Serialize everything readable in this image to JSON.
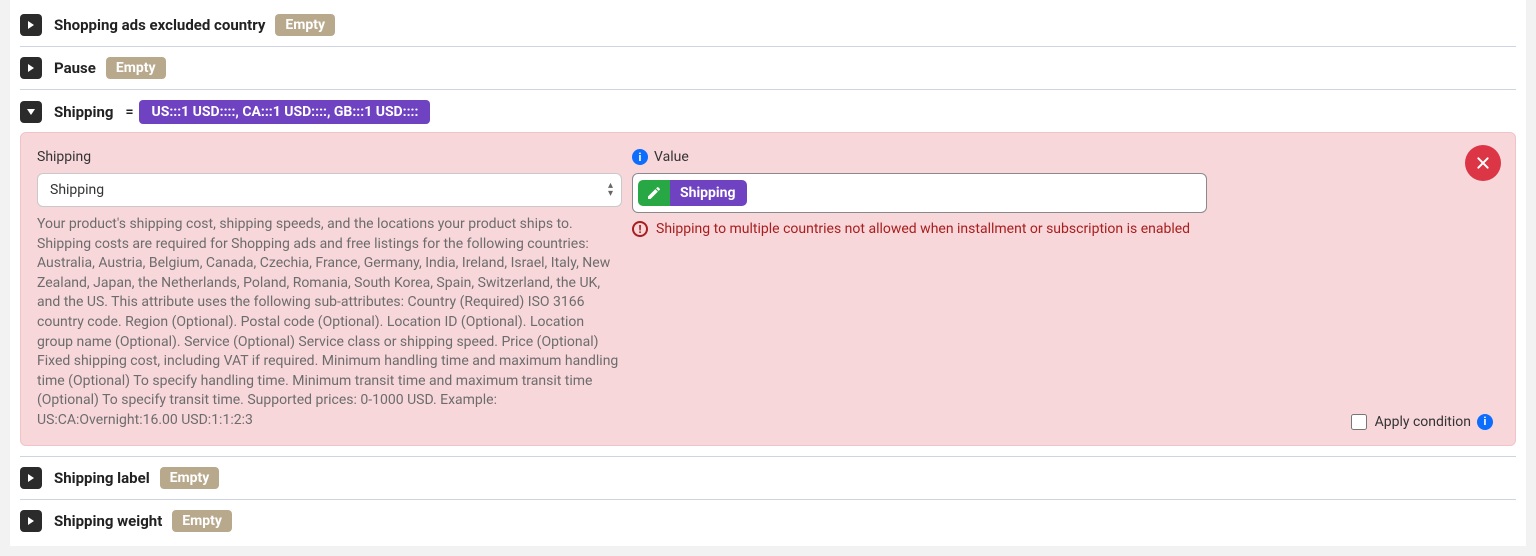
{
  "rows": {
    "excluded_country_label": "Shopping ads excluded country",
    "excluded_country_badge": "Empty",
    "pause_label": "Pause",
    "pause_badge": "Empty",
    "shipping_label": "Shipping",
    "shipping_eq": "=",
    "shipping_value_summary": "US:::1 USD::::, CA:::1 USD::::, GB:::1 USD::::",
    "shipping_label_row_label": "Shipping label",
    "shipping_label_badge": "Empty",
    "shipping_weight_label": "Shipping weight",
    "shipping_weight_badge": "Empty"
  },
  "expanded": {
    "left_label": "Shipping",
    "select_value": "Shipping",
    "help_text": "Your product's shipping cost, shipping speeds, and the locations your product ships to. Shipping costs are required for Shopping ads and free listings for the following countries: Australia, Austria, Belgium, Canada, Czechia, France, Germany, India, Ireland, Israel, Italy, New Zealand, Japan, the Netherlands, Poland, Romania, South Korea, Spain, Switzerland, the UK, and the US. This attribute uses the following sub-attributes: Country (Required) ISO 3166 country code. Region (Optional). Postal code (Optional). Location ID (Optional). Location group name (Optional). Service (Optional) Service class or shipping speed. Price (Optional) Fixed shipping cost, including VAT if required. Minimum handling time and maximum handling time (Optional) To specify handling time. Minimum transit time and maximum transit time (Optional) To specify transit time. Supported prices: 0-1000 USD. Example: US:CA:Overnight:16.00 USD:1:1:2:3",
    "right_label": "Value",
    "value_chip_text": "Shipping",
    "error_text": "Shipping to multiple countries not allowed when installment or subscription is enabled",
    "apply_condition_label": "Apply condition"
  }
}
